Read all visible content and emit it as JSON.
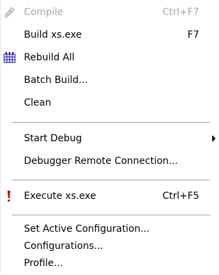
{
  "menu": {
    "items": [
      {
        "label": "Compile",
        "shortcut": "Ctrl+F7",
        "icon": "compile-icon",
        "disabled": true
      },
      {
        "label": "Build xs.exe",
        "shortcut": "F7",
        "icon": ""
      },
      {
        "label": "Rebuild All",
        "shortcut": "",
        "icon": "rebuild-all-icon"
      },
      {
        "label": "Batch Build...",
        "shortcut": "",
        "icon": ""
      },
      {
        "label": "Clean",
        "shortcut": "",
        "icon": ""
      },
      {
        "label": "Start Debug",
        "shortcut": "",
        "icon": "",
        "submenu": true
      },
      {
        "label": "Debugger Remote Connection...",
        "shortcut": "",
        "icon": ""
      },
      {
        "label": "Execute xs.exe",
        "shortcut": "Ctrl+F5",
        "icon": "execute-icon"
      },
      {
        "label": "Set Active Configuration...",
        "shortcut": "",
        "icon": ""
      },
      {
        "label": "Configurations...",
        "shortcut": "",
        "icon": ""
      },
      {
        "label": "Profile...",
        "shortcut": "",
        "icon": ""
      }
    ]
  },
  "colors": {
    "text": "#000000",
    "disabled_text": "#a6a6a6",
    "separator": "#a0a0a0",
    "execute_icon": "#c00000",
    "rebuild_icon": "#0000c0"
  }
}
